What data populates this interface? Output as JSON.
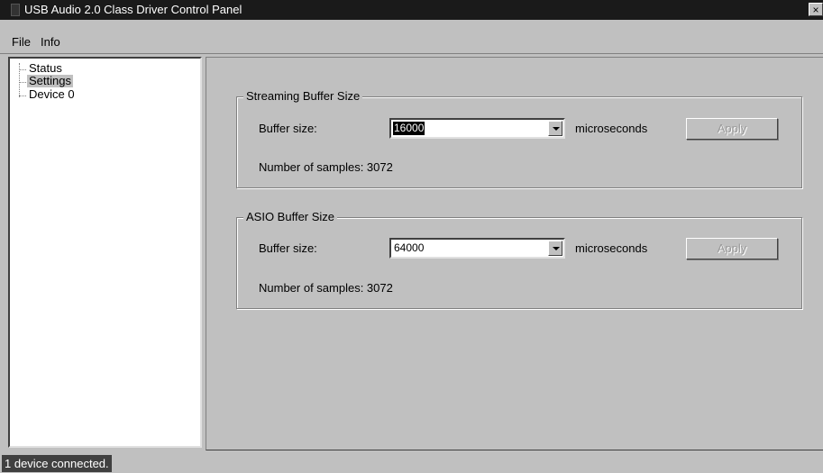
{
  "window": {
    "title": "USB Audio 2.0 Class Driver Control Panel",
    "close_glyph": "×"
  },
  "menu": {
    "items": [
      {
        "label": "File"
      },
      {
        "label": "Info"
      }
    ]
  },
  "tree": {
    "items": [
      {
        "label": "Status",
        "selected": false
      },
      {
        "label": "Settings",
        "selected": true
      },
      {
        "label": "Device 0",
        "selected": false
      }
    ]
  },
  "streaming": {
    "title": "Streaming Buffer Size",
    "buffer_label": "Buffer size:",
    "buffer_value": "16000",
    "unit": "microseconds",
    "apply_label": "Apply",
    "samples_text": "Number of samples: 3072"
  },
  "asio": {
    "title": "ASIO Buffer Size",
    "buffer_label": "Buffer size:",
    "buffer_value": "64000",
    "unit": "microseconds",
    "apply_label": "Apply",
    "samples_text": "Number of samples: 3072"
  },
  "status": {
    "text": "1 device connected."
  },
  "icons": {
    "app": "app-icon",
    "close": "close-icon",
    "dropdown": "chevron-down-icon"
  }
}
